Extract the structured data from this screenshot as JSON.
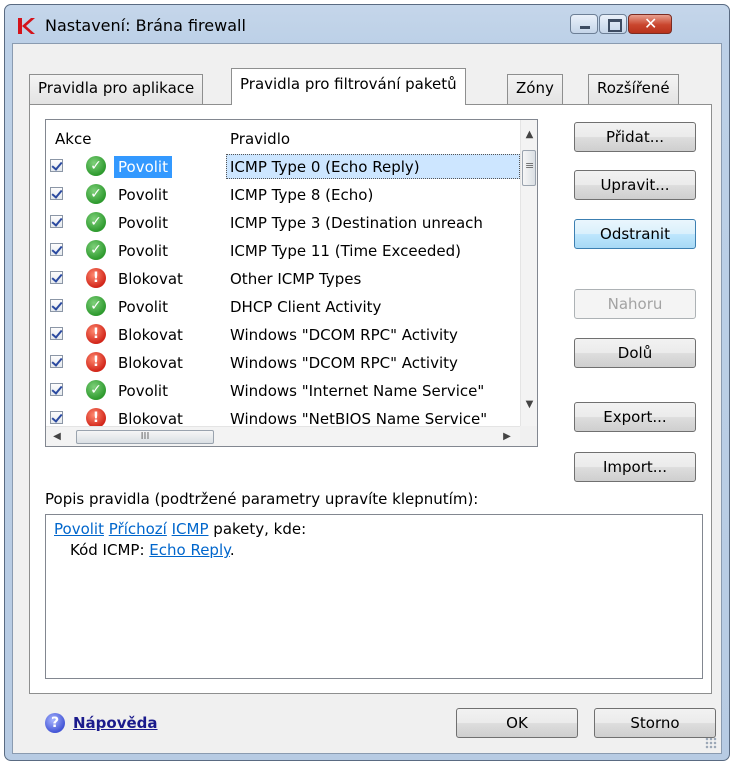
{
  "window": {
    "title": "Nastavení: Brána firewall",
    "controls": {
      "minimize": "minimize-icon",
      "maximize": "maximize-icon",
      "close": "close-icon"
    }
  },
  "tabs": [
    {
      "label": "Pravidla pro aplikace",
      "active": false
    },
    {
      "label": "Pravidla pro filtrování paketů",
      "active": true
    },
    {
      "label": "Zóny",
      "active": false
    },
    {
      "label": "Rozšířené",
      "active": false
    }
  ],
  "list": {
    "headers": {
      "action": "Akce",
      "rule": "Pravidlo"
    },
    "rows": [
      {
        "checked": true,
        "type": "allow",
        "action": "Povolit",
        "rule": "ICMP Type 0 (Echo Reply)",
        "selected": true
      },
      {
        "checked": true,
        "type": "allow",
        "action": "Povolit",
        "rule": "ICMP Type 8 (Echo)"
      },
      {
        "checked": true,
        "type": "allow",
        "action": "Povolit",
        "rule": "ICMP Type 3 (Destination unreach"
      },
      {
        "checked": true,
        "type": "allow",
        "action": "Povolit",
        "rule": "ICMP Type 11 (Time Exceeded)"
      },
      {
        "checked": true,
        "type": "block",
        "action": "Blokovat",
        "rule": "Other ICMP Types"
      },
      {
        "checked": true,
        "type": "allow",
        "action": "Povolit",
        "rule": "DHCP Client Activity"
      },
      {
        "checked": true,
        "type": "block",
        "action": "Blokovat",
        "rule": "Windows \"DCOM RPC\" Activity"
      },
      {
        "checked": true,
        "type": "block",
        "action": "Blokovat",
        "rule": "Windows \"DCOM RPC\" Activity"
      },
      {
        "checked": true,
        "type": "allow",
        "action": "Povolit",
        "rule": "Windows \"Internet Name Service\""
      },
      {
        "checked": true,
        "type": "block",
        "action": "Blokovat",
        "rule": "Windows \"NetBIOS Name Service\""
      }
    ],
    "hscroll_thumb": "III"
  },
  "buttons": {
    "add": "Přidat...",
    "edit": "Upravit...",
    "remove": "Odstranit",
    "up": "Nahoru",
    "down": "Dolů",
    "export": "Export...",
    "import": "Import..."
  },
  "description": {
    "label": "Popis pravidla (podtržené parametry upravíte klepnutím):",
    "line1": {
      "link1": "Povolit",
      "link2": "Příchozí",
      "link3": "ICMP",
      "text": "pakety, kde:"
    },
    "line2": {
      "text": "Kód ICMP:",
      "link": "Echo Reply",
      "end": "."
    }
  },
  "footer": {
    "help": "Nápověda",
    "ok": "OK",
    "cancel": "Storno"
  },
  "colors": {
    "selection": "#3399ff",
    "link": "#0066cc",
    "allow": "#2e9a2e",
    "block": "#d2261a"
  }
}
